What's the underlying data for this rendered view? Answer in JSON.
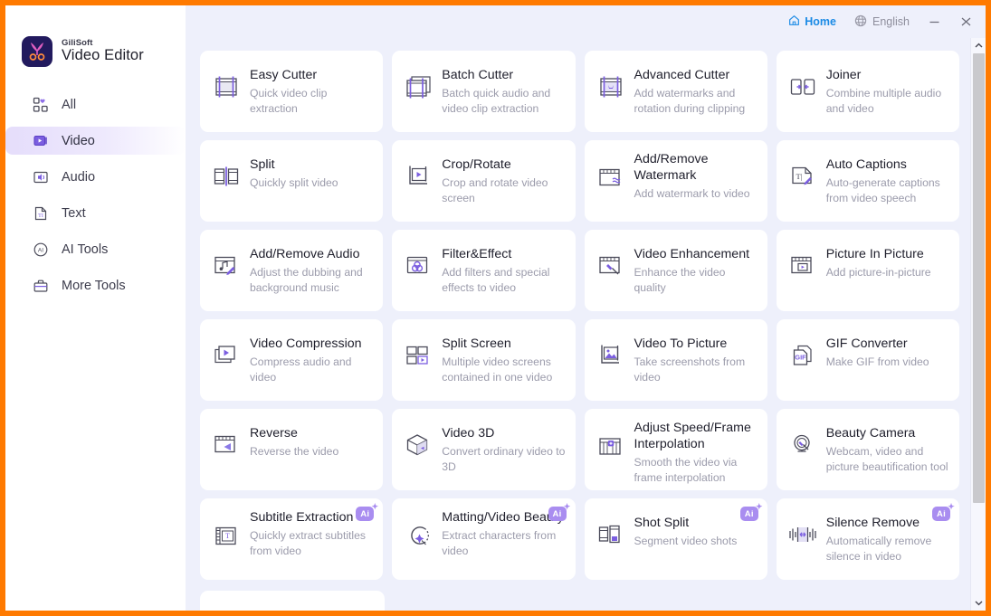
{
  "window": {
    "accent_border": "#ff7a00",
    "background": "#eef0fb"
  },
  "logo": {
    "brand": "GiliSoft",
    "product": "Video Editor",
    "mark_icon": "scissors-icon",
    "mark_color": "#221a5e"
  },
  "titlebar": {
    "home_label": "Home",
    "home_icon": "home-icon",
    "home_color": "#1a8ae5",
    "language_label": "English",
    "language_icon": "globe-icon",
    "minimize_icon": "minimize-icon",
    "close_icon": "close-icon"
  },
  "sidebar": {
    "items": [
      {
        "label": "All",
        "icon": "grid-heart-icon",
        "active": false
      },
      {
        "label": "Video",
        "icon": "video-icon",
        "active": true
      },
      {
        "label": "Audio",
        "icon": "speaker-icon",
        "active": false
      },
      {
        "label": "Text",
        "icon": "text-file-icon",
        "active": false
      },
      {
        "label": "AI Tools",
        "icon": "ai-circle-icon",
        "active": false
      },
      {
        "label": "More Tools",
        "icon": "toolbox-icon",
        "active": false
      }
    ],
    "active_highlight": "#e5ddfb"
  },
  "scrollbar": {
    "up_icon": "chevron-up-icon",
    "down_icon": "chevron-down-icon",
    "thumb_color": "#c9c9cd"
  },
  "grid": {
    "ai_badge_label": "Ai",
    "ai_badge_color": "#a98df0",
    "cards": [
      {
        "title": "Easy Cutter",
        "desc": "Quick video clip extraction",
        "icon": "film-cut-icon",
        "ai": false
      },
      {
        "title": "Batch Cutter",
        "desc": "Batch quick audio and video clip extraction",
        "icon": "film-stack-cut-icon",
        "ai": false
      },
      {
        "title": "Advanced Cutter",
        "desc": "Add watermarks and rotation during clipping",
        "icon": "film-advanced-icon",
        "ai": false
      },
      {
        "title": "Joiner",
        "desc": "Combine multiple audio and video",
        "icon": "join-arrows-icon",
        "ai": false
      },
      {
        "title": "Split",
        "desc": "Quickly split video",
        "icon": "split-frames-icon",
        "ai": false
      },
      {
        "title": "Crop/Rotate",
        "desc": "Crop and rotate video screen",
        "icon": "crop-play-icon",
        "ai": false
      },
      {
        "title": "Add/Remove Watermark",
        "desc": "Add watermark to video",
        "icon": "watermark-icon",
        "ai": false
      },
      {
        "title": "Auto Captions",
        "desc": "Auto-generate captions from video speech",
        "icon": "caption-pen-icon",
        "ai": false
      },
      {
        "title": "Add/Remove Audio",
        "desc": "Adjust the dubbing and background music",
        "icon": "audio-note-pen-icon",
        "ai": false
      },
      {
        "title": "Filter&Effect",
        "desc": "Add filters and special effects to video",
        "icon": "filter-circles-icon",
        "ai": false
      },
      {
        "title": "Video Enhancement",
        "desc": "Enhance the video quality",
        "icon": "enhance-wand-icon",
        "ai": false
      },
      {
        "title": "Picture In Picture",
        "desc": "Add picture-in-picture",
        "icon": "pip-icon",
        "ai": false
      },
      {
        "title": "Video Compression",
        "desc": "Compress audio and video",
        "icon": "compress-stack-icon",
        "ai": false
      },
      {
        "title": "Split Screen",
        "desc": "Multiple video screens contained in one video",
        "icon": "split-screen-icon",
        "ai": false
      },
      {
        "title": "Video To Picture",
        "desc": "Take screenshots from video",
        "icon": "image-frame-icon",
        "ai": false
      },
      {
        "title": "GIF Converter",
        "desc": "Make GIF from video",
        "icon": "gif-page-icon",
        "ai": false
      },
      {
        "title": "Reverse",
        "desc": "Reverse the video",
        "icon": "reverse-arrow-icon",
        "ai": false
      },
      {
        "title": "Video 3D",
        "desc": "Convert ordinary video to 3D",
        "icon": "cube-3d-icon",
        "ai": false
      },
      {
        "title": "Adjust Speed/Frame Interpolation",
        "desc": "Smooth the video via frame interpolation",
        "icon": "frame-speed-icon",
        "ai": false
      },
      {
        "title": "Beauty Camera",
        "desc": "Webcam, video and picture beautification tool",
        "icon": "camera-wand-icon",
        "ai": false
      },
      {
        "title": "Subtitle Extraction",
        "desc": "Quickly extract subtitles from video",
        "icon": "subtitle-film-icon",
        "ai": true
      },
      {
        "title": "Matting/Video Beauty",
        "desc": "Extract characters from video",
        "icon": "matting-wand-icon",
        "ai": true
      },
      {
        "title": "Shot Split",
        "desc": "Segment video shots",
        "icon": "shot-split-icon",
        "ai": true
      },
      {
        "title": "Silence Remove",
        "desc": "Automatically remove silence in video",
        "icon": "waveform-cut-icon",
        "ai": true
      }
    ]
  }
}
